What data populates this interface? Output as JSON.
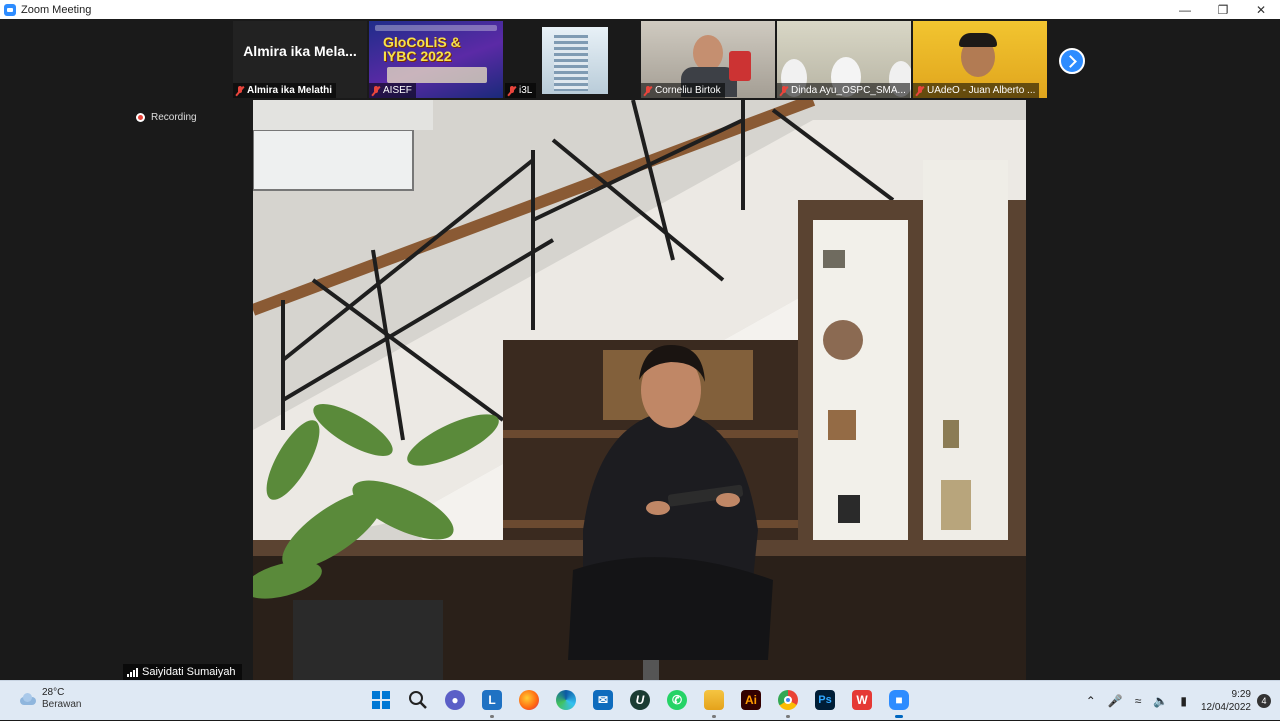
{
  "window": {
    "title": "Zoom Meeting"
  },
  "thumbnails": [
    {
      "name": "Almira ika Melathi",
      "display": "Almira  ika  Mela...",
      "type": "name-only"
    },
    {
      "name": "AISEF",
      "type": "poster",
      "poster_text": "GloCoLiS & IYBC 2022"
    },
    {
      "name": "i3L",
      "type": "building"
    },
    {
      "name": "Corneliu Birtok",
      "type": "camera-room"
    },
    {
      "name": "Dinda Ayu_OSPC_SMA...",
      "type": "camera-girls"
    },
    {
      "name": "UAdeO - Juan Alberto ...",
      "type": "camera-yellow"
    }
  ],
  "recording": {
    "label": "Recording"
  },
  "speaker": {
    "name": "Saiyidati Sumaiyah"
  },
  "taskbar": {
    "weather": {
      "temp": "28°C",
      "condition": "Berawan"
    },
    "apps": [
      "start",
      "search",
      "teams-chat",
      "lexi",
      "firefox",
      "edge",
      "mail",
      "upwork",
      "whatsapp",
      "file-explorer",
      "illustrator",
      "chrome",
      "photoshop",
      "wps-office",
      "zoom"
    ],
    "clock": {
      "time": "9:29",
      "date": "12/04/2022"
    },
    "notification_count": "4"
  }
}
